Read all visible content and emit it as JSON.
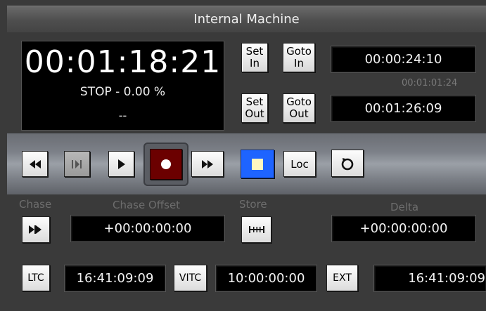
{
  "window": {
    "title": "Internal Machine"
  },
  "display": {
    "timecode": "00:01:18:21",
    "status": "STOP - 0.00 %",
    "extra": "--"
  },
  "locate": {
    "set_in_label": "Set\nIn",
    "goto_in_label": "Goto\nIn",
    "set_out_label": "Set\nOut",
    "goto_out_label": "Goto\nOut",
    "in_time": "00:00:24:10",
    "duration": "00:01:01:24",
    "out_time": "00:01:26:09"
  },
  "transport": {
    "rewind_icon": "rewind-icon",
    "step_icon": "step-frame-icon",
    "play_icon": "play-icon",
    "record_icon": "record-icon",
    "fast_forward_icon": "fast-forward-icon",
    "stop_icon": "stop-icon",
    "loc_label": "Loc",
    "loop_icon": "loop-icon",
    "record_color": "#6b0000",
    "stop_color": "#1e64ff"
  },
  "chase": {
    "chase_label": "Chase",
    "chase_offset_label": "Chase Offset",
    "store_label": "Store",
    "delta_label": "Delta",
    "chase_offset_value": "+00:00:00:00",
    "delta_value": "+00:00:00:00"
  },
  "sync": {
    "ltc_label": "LTC",
    "ltc_value": "16:41:09:09",
    "vitc_label": "VITC",
    "vitc_value": "10:00:00:00",
    "ext_label": "EXT",
    "ext_value": "16:41:09:09"
  }
}
